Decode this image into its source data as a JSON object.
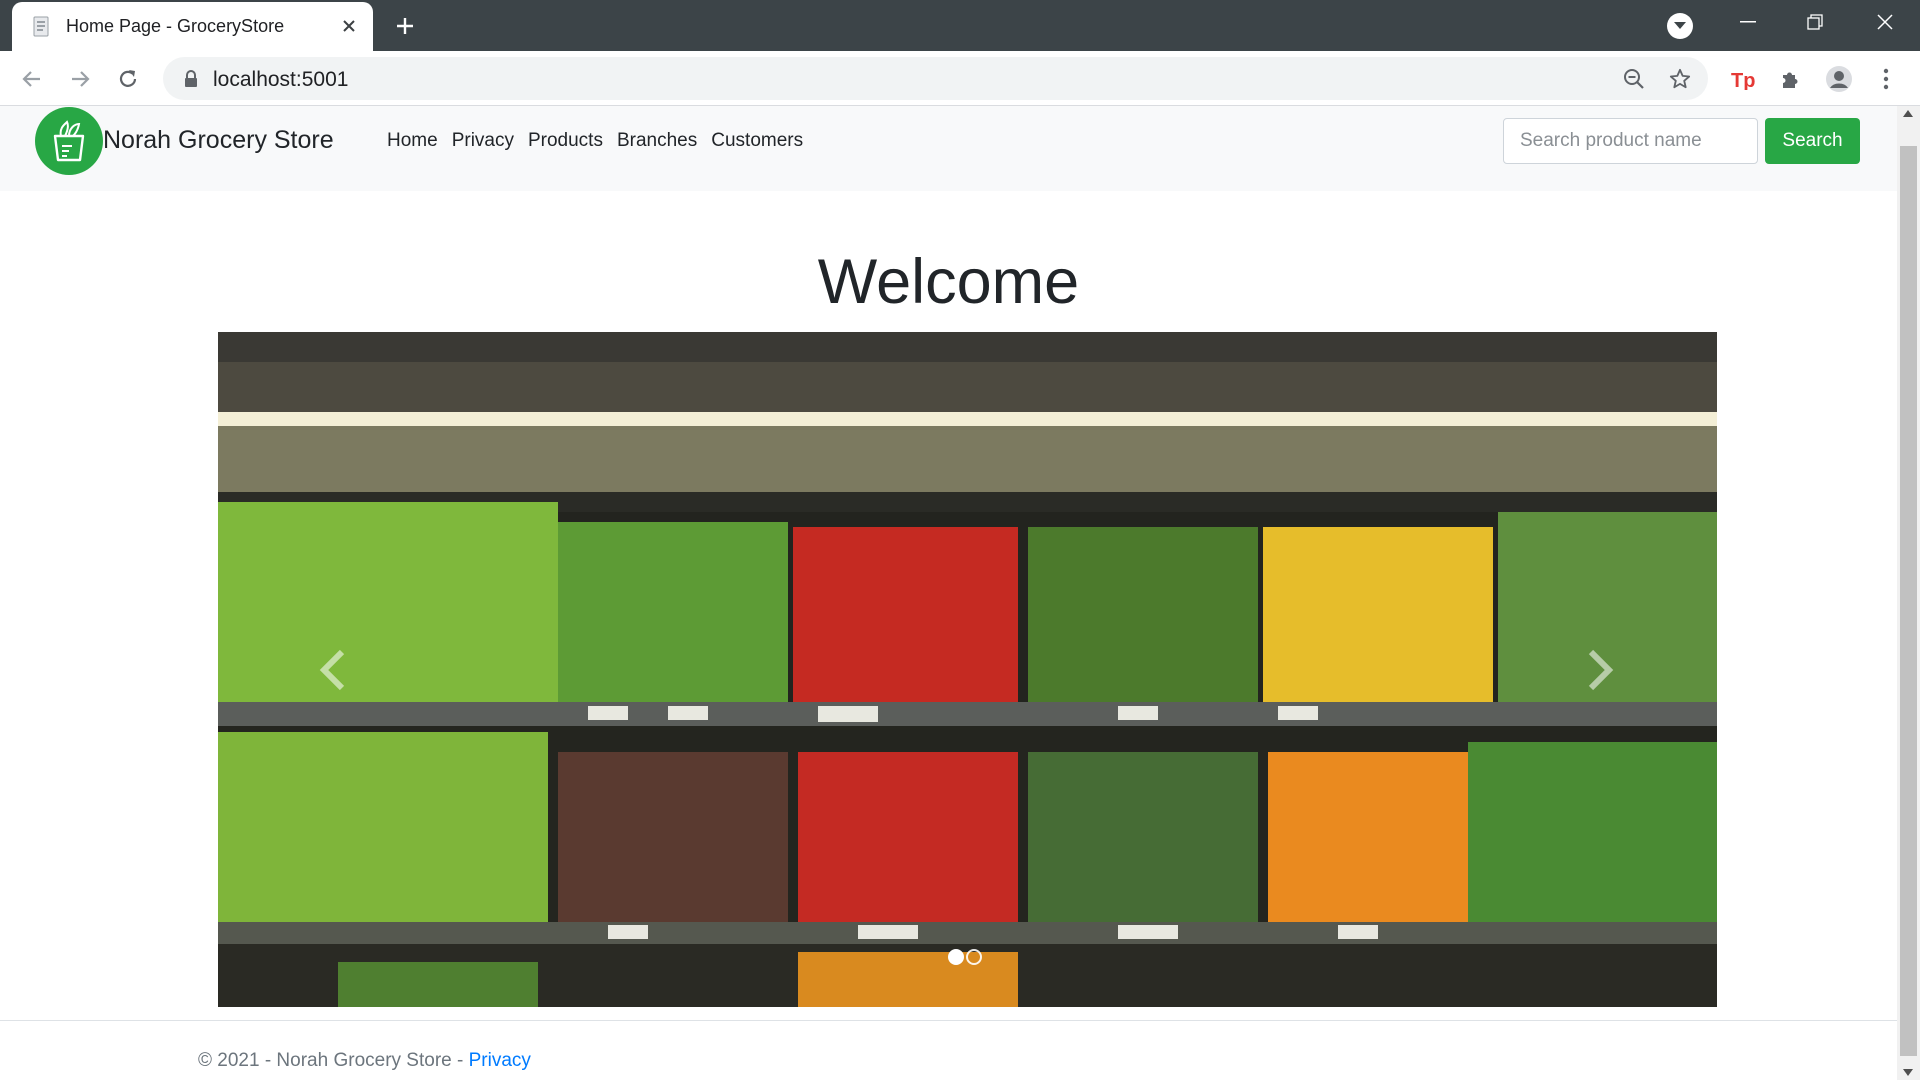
{
  "browser": {
    "tab_title": "Home Page - GroceryStore",
    "url": "localhost:5001"
  },
  "site": {
    "brand": "Norah Grocery Store",
    "nav": [
      {
        "label": "Home"
      },
      {
        "label": "Privacy"
      },
      {
        "label": "Products"
      },
      {
        "label": "Branches"
      },
      {
        "label": "Customers"
      }
    ],
    "search": {
      "placeholder": "Search product name",
      "value": "",
      "button_label": "Search"
    },
    "colors": {
      "brand_green": "#28a745",
      "navbar_bg": "#f8f9fa",
      "link_blue": "#007bff"
    }
  },
  "main": {
    "heading": "Welcome",
    "carousel": {
      "slide_count": 2,
      "active_slide": 1,
      "prev_icon": "chevron-left-icon",
      "next_icon": "chevron-right-icon"
    }
  },
  "footer": {
    "text": "© 2021 - Norah Grocery Store - ",
    "link_label": "Privacy"
  }
}
